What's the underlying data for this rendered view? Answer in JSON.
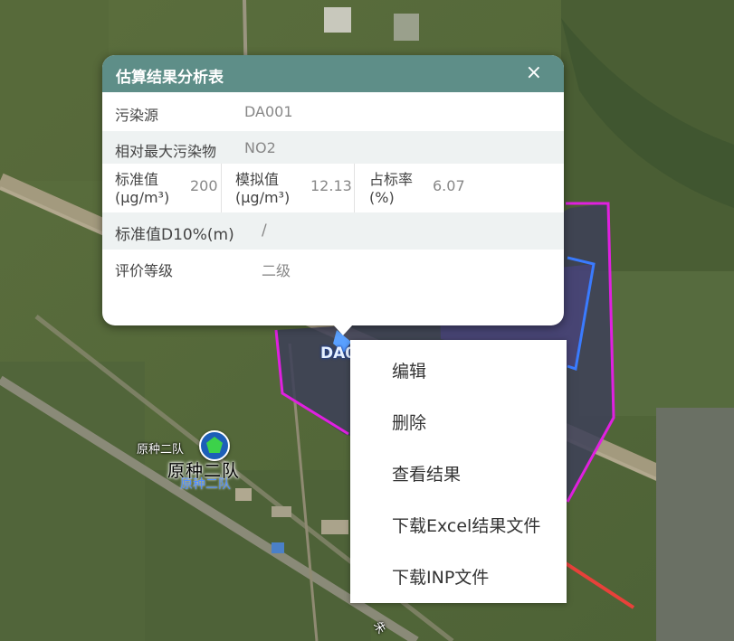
{
  "popup": {
    "title": "估算结果分析表",
    "close": "×",
    "source_label": "污染源",
    "source_value": "DA001",
    "pollutant_label": "相对最大污染物",
    "pollutant_value": "NO2",
    "std_label_line1": "标准值",
    "std_label_line2": "(μg/m³)",
    "std_value": "200",
    "sim_label_line1": "模拟值",
    "sim_label_line2": "(μg/m³)",
    "sim_value": "12.13",
    "ratio_label_line1": "占标率",
    "ratio_label_line2": "(%)",
    "ratio_value": "6.07",
    "d10_label": "标准值D10%(m)",
    "d10_value": "/",
    "grade_label": "评价等级",
    "grade_value": "二级"
  },
  "context_menu": {
    "items": [
      "编辑",
      "删除",
      "查看结果",
      "下载Excel结果文件",
      "下载INP文件"
    ]
  },
  "map": {
    "poi_small": "原种二队",
    "poi_big": "原种二队",
    "poi_shadow": "原种二队",
    "source_marker_label": "DA0",
    "road_label": "朱"
  },
  "colors": {
    "header": "#5e8e88",
    "polygon_magenta": "#e020e0",
    "polygon_blue": "#3a7bff",
    "arrow": "#e8413a"
  }
}
